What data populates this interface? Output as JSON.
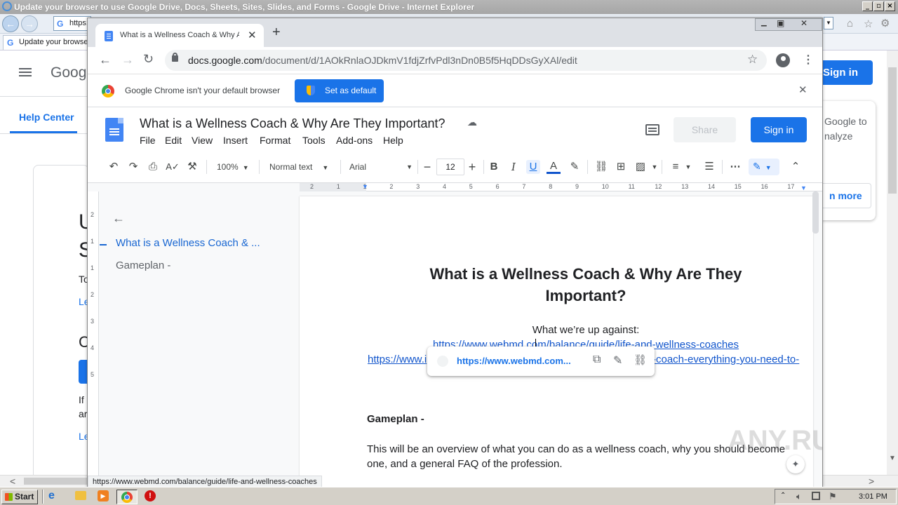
{
  "ie": {
    "window_title": "Update your browser to use Google Drive, Docs, Sheets, Sites, Slides, and Forms - Google Drive  - Internet Explorer",
    "address_partial": "https:",
    "tab_label": "Update your browse",
    "page": {
      "logo_partial": "Goog",
      "help_center": "Help Center",
      "sign_in": "Sign in",
      "side_card_text_1": "Google to",
      "side_card_text_2": "nalyze",
      "learn_more_partial": "n more",
      "left_letters": [
        "U",
        "S",
        "To",
        "Le",
        "C",
        "If",
        "ar",
        "Le"
      ]
    }
  },
  "chrome": {
    "tab_title": "What is a Wellness Coach & Why Ar",
    "url_host": "docs.google.com",
    "url_path": "/document/d/1AOkRnlaOJDkmV1fdjZrfvPdl3nDn0B5f5HqDDsGyXAl/edit",
    "infobar_text": "Google Chrome isn't your default browser",
    "infobar_button": "Set as default"
  },
  "docs": {
    "doc_title": "What is a Wellness Coach & Why Are They Important?",
    "menu": [
      "File",
      "Edit",
      "View",
      "Insert",
      "Format",
      "Tools",
      "Add-ons",
      "Help"
    ],
    "share_label": "Share",
    "signin_label": "Sign in",
    "zoom": "100%",
    "style": "Normal text",
    "font": "Arial",
    "font_size": "12",
    "ruler_numbers": [
      "2",
      "1",
      "1",
      "2",
      "3",
      "4",
      "5",
      "6",
      "7",
      "8",
      "9",
      "10",
      "11",
      "12",
      "13",
      "14",
      "15",
      "16",
      "17"
    ],
    "vruler_numbers": [
      "2",
      "1",
      "1",
      "2",
      "3",
      "4",
      "5"
    ],
    "outline": [
      {
        "label": "What is a Wellness Coach & ...",
        "active": true
      },
      {
        "label": "Gameplan -",
        "active": false
      }
    ],
    "heading_line1": "What is a Wellness Coach & Why Are They",
    "heading_line2": "Important?",
    "subheading": "What we’re up against:",
    "link1": "https://www.webmd.com/balance/guide/life-and-wellness-coaches",
    "link2_start": "https://www.i",
    "link2_end": "-coach-everything-you-need-to-",
    "link_popup_url": "https://www.webmd.com...",
    "gameplan_heading": "Gameplan -",
    "body_line1": "This will be an overview of what you can do as a wellness coach, why you should become",
    "body_line2": "one, and a general FAQ of the profession."
  },
  "status_bar_url": "https://www.webmd.com/balance/guide/life-and-wellness-coaches",
  "watermark": "ANY.RUN",
  "taskbar": {
    "start": "Start",
    "clock": "3:01 PM"
  },
  "colors": {
    "accent_blue": "#1a73e8",
    "link_blue": "#1155cc",
    "docs_blue": "#4285f4"
  }
}
